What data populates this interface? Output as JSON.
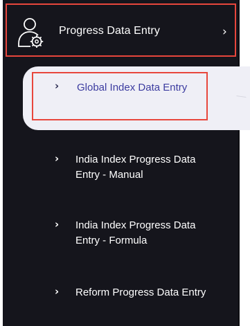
{
  "menu": {
    "header": {
      "label": "Progress Data Entry",
      "chevron": "›",
      "icon": "user-gear-icon"
    },
    "items": [
      {
        "chevron": "›",
        "label": "Global Index Data Entry",
        "active": true
      },
      {
        "chevron": "›",
        "label": "India Index Progress Data Entry - Manual"
      },
      {
        "chevron": "›",
        "label": "India Index Progress Data Entry - Formula"
      },
      {
        "chevron": "›",
        "label": "Reform Progress Data Entry"
      }
    ]
  },
  "colors": {
    "sidebar_bg": "#15151c",
    "highlight_border": "#e8463c",
    "active_bg": "#efeff6",
    "active_text": "#3c3ca0",
    "text": "#ffffff"
  }
}
